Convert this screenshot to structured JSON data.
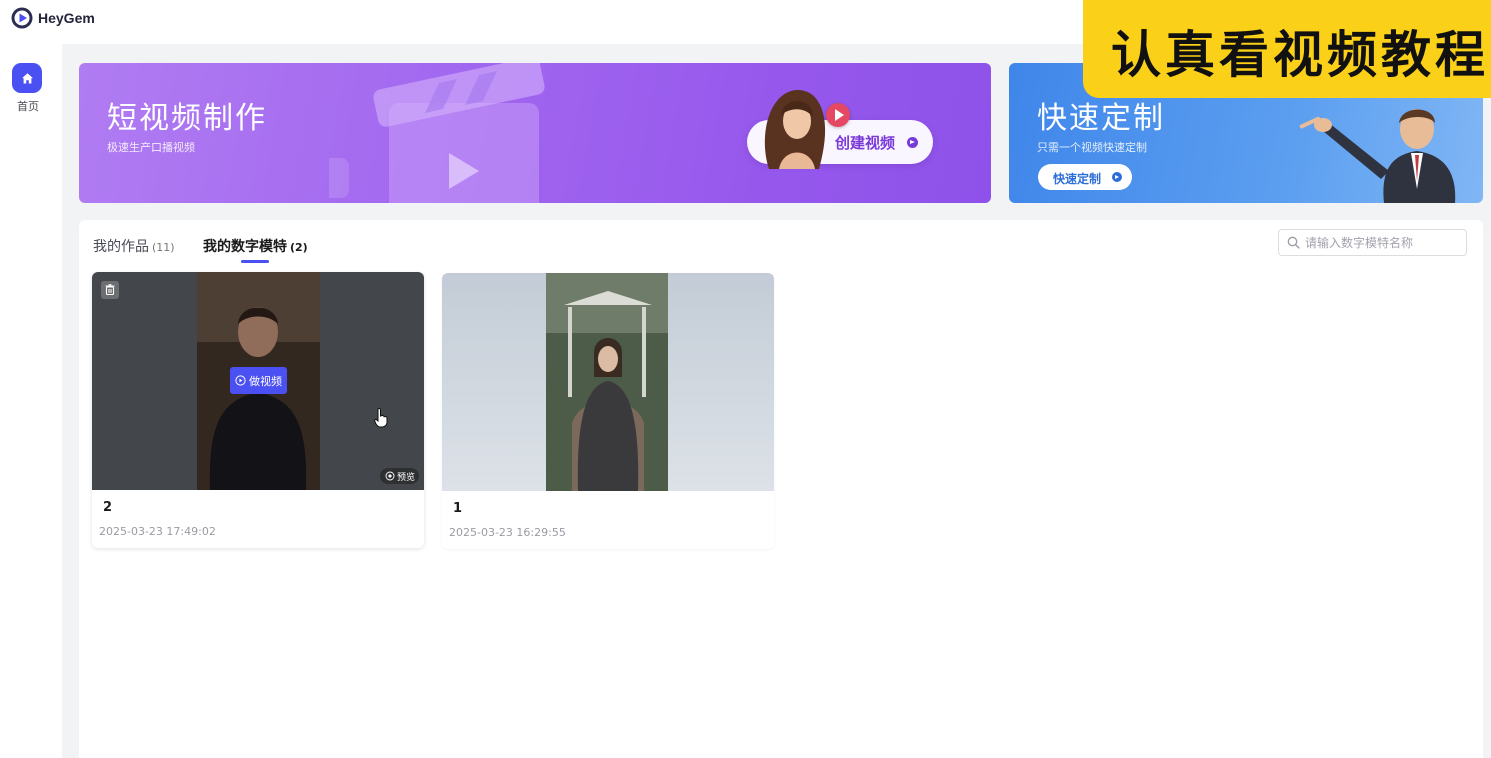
{
  "app": {
    "name": "HeyGem"
  },
  "sidebar": {
    "items": [
      {
        "label": "首页",
        "icon": "home-icon",
        "active": true
      }
    ]
  },
  "banners": {
    "short_video": {
      "title": "短视频制作",
      "subtitle": "极速生产口播视频",
      "button_label": "创建视频"
    },
    "custom": {
      "title": "快速定制",
      "subtitle": "只需一个视频快速定制",
      "button_label": "快速定制"
    }
  },
  "overlay_caption": "认真看视频教程",
  "tabs": [
    {
      "label": "我的作品",
      "count": "(11)",
      "active": false
    },
    {
      "label": "我的数字模特",
      "count": "(2)",
      "active": true
    }
  ],
  "search": {
    "placeholder": "请输入数字模特名称",
    "value": ""
  },
  "models": [
    {
      "name": "2",
      "date": "2025-03-23 17:49:02",
      "make_video_label": "做视频",
      "preview_label": "预览"
    },
    {
      "name": "1",
      "date": "2025-03-23 16:29:55"
    }
  ],
  "colors": {
    "accent": "#4b50f2",
    "purple_banner": "#a46af0",
    "blue_banner": "#3f86ea",
    "caption_yellow": "#fbd018"
  }
}
